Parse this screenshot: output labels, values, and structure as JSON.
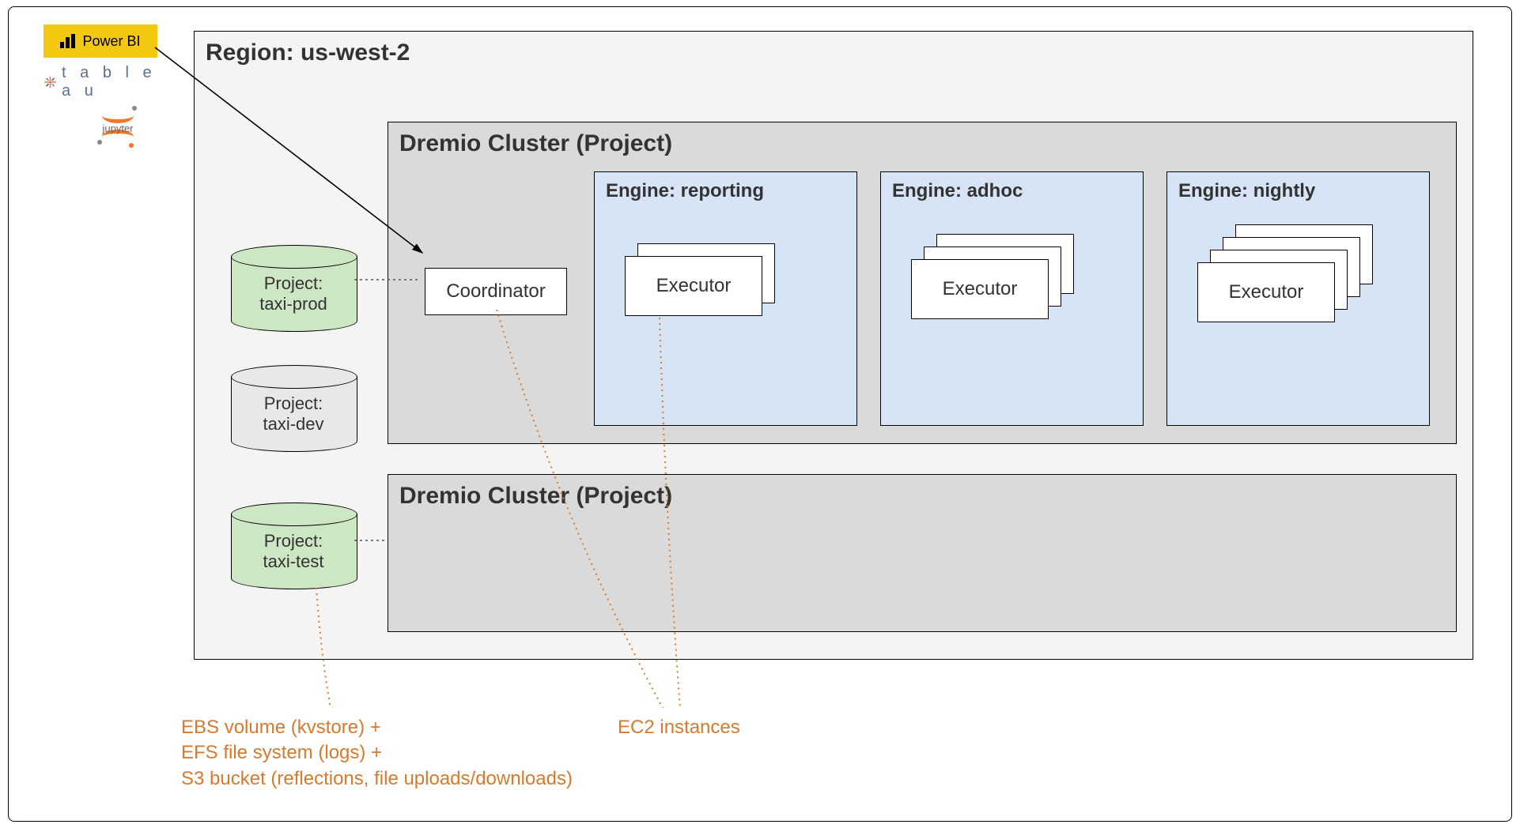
{
  "logos": {
    "powerbi": "Power BI",
    "tableau": "t a b l e a u",
    "jupyter": "jupyter"
  },
  "region": {
    "label": "Region: us-west-2"
  },
  "cluster1": {
    "label": "Dremio Cluster (Project)",
    "coordinator": "Coordinator",
    "engines": {
      "reporting": {
        "label": "Engine: reporting",
        "executor": "Executor"
      },
      "adhoc": {
        "label": "Engine: adhoc",
        "executor": "Executor"
      },
      "nightly": {
        "label": "Engine: nightly",
        "executor": "Executor"
      }
    }
  },
  "cluster2": {
    "label": "Dremio Cluster (Project)"
  },
  "projects": {
    "prod": {
      "line1": "Project:",
      "line2": "taxi-prod"
    },
    "dev": {
      "line1": "Project:",
      "line2": "taxi-dev"
    },
    "test": {
      "line1": "Project:",
      "line2": "taxi-test"
    }
  },
  "annotations": {
    "storage_l1": "EBS volume (kvstore) +",
    "storage_l2": "EFS file system (logs) +",
    "storage_l3": "S3 bucket (reflections, file uploads/downloads)",
    "ec2": "EC2 instances"
  },
  "colors": {
    "accent_orange": "#d67a2e",
    "engine_fill": "#d6e4f5",
    "project_green": "#cde6c3",
    "project_grey": "#e8e8e8",
    "powerbi_yellow": "#f2c811"
  }
}
